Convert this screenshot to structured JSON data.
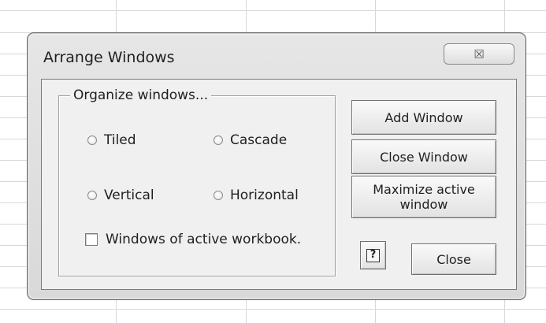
{
  "dialog": {
    "title": "Arrange Windows",
    "close_glyph": "☒"
  },
  "organize": {
    "legend": "Organize  windows...",
    "options": {
      "tiled": "Tiled",
      "cascade": "Cascade",
      "vertical": "Vertical",
      "horizontal": "Horizontal"
    },
    "active_workbook_checkbox": "Windows of active workbook."
  },
  "buttons": {
    "add_window": "Add Window",
    "close_window": "Close Window",
    "maximize_active_window": "Maximize active window",
    "help": "?",
    "close": "Close"
  },
  "colors": {
    "dialog_background": "#f0f0f0",
    "grid_lines": "#d6d8dc"
  }
}
